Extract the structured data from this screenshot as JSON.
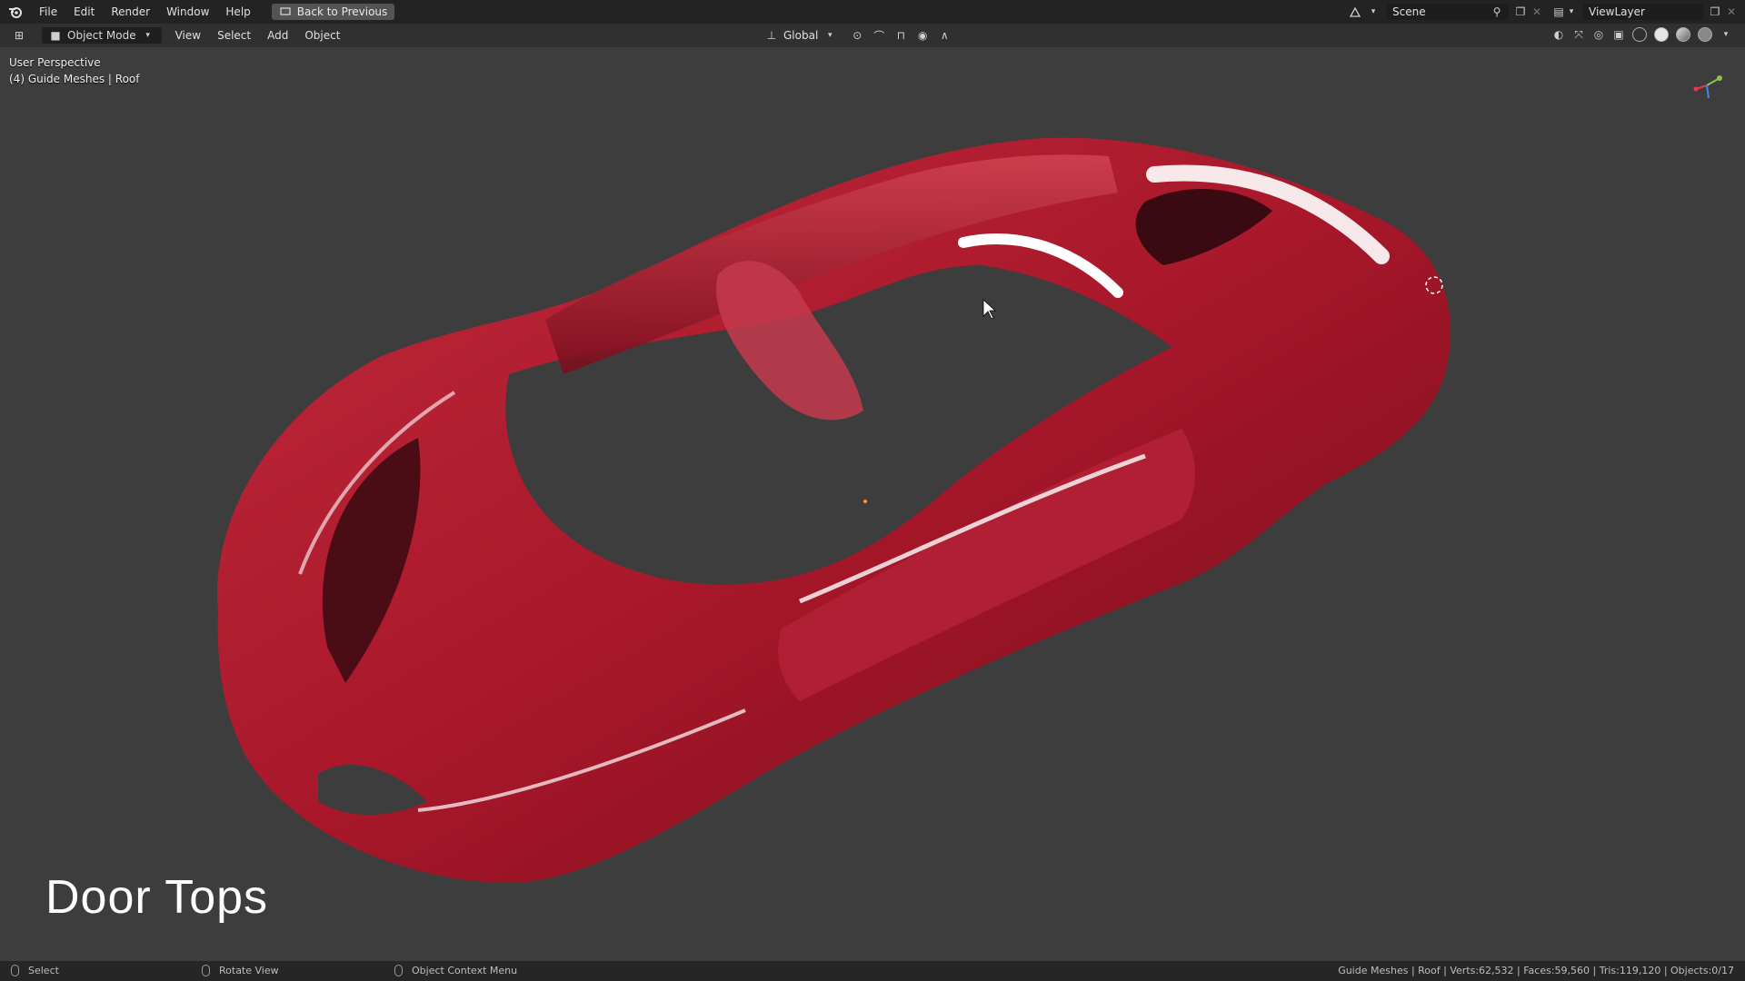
{
  "menu": {
    "items": [
      "File",
      "Edit",
      "Render",
      "Window",
      "Help"
    ],
    "back_button": "Back to Previous"
  },
  "scene": {
    "name": "Scene",
    "view_layer": "ViewLayer"
  },
  "header": {
    "mode": "Object Mode",
    "menus": [
      "View",
      "Select",
      "Add",
      "Object"
    ],
    "orientation": "Global"
  },
  "viewport": {
    "perspective": "User Perspective",
    "collection": "(4) Guide Meshes | Roof",
    "caption": "Door Tops"
  },
  "status": {
    "select": "Select",
    "rotate": "Rotate View",
    "context": "Object Context Menu",
    "stats": "Guide Meshes | Roof | Verts:62,532 | Faces:59,560 | Tris:119,120 | Objects:0/17"
  },
  "colors": {
    "body_red": "#a8172a",
    "highlight": "#ffffff",
    "bg": "#3d3d3d"
  }
}
